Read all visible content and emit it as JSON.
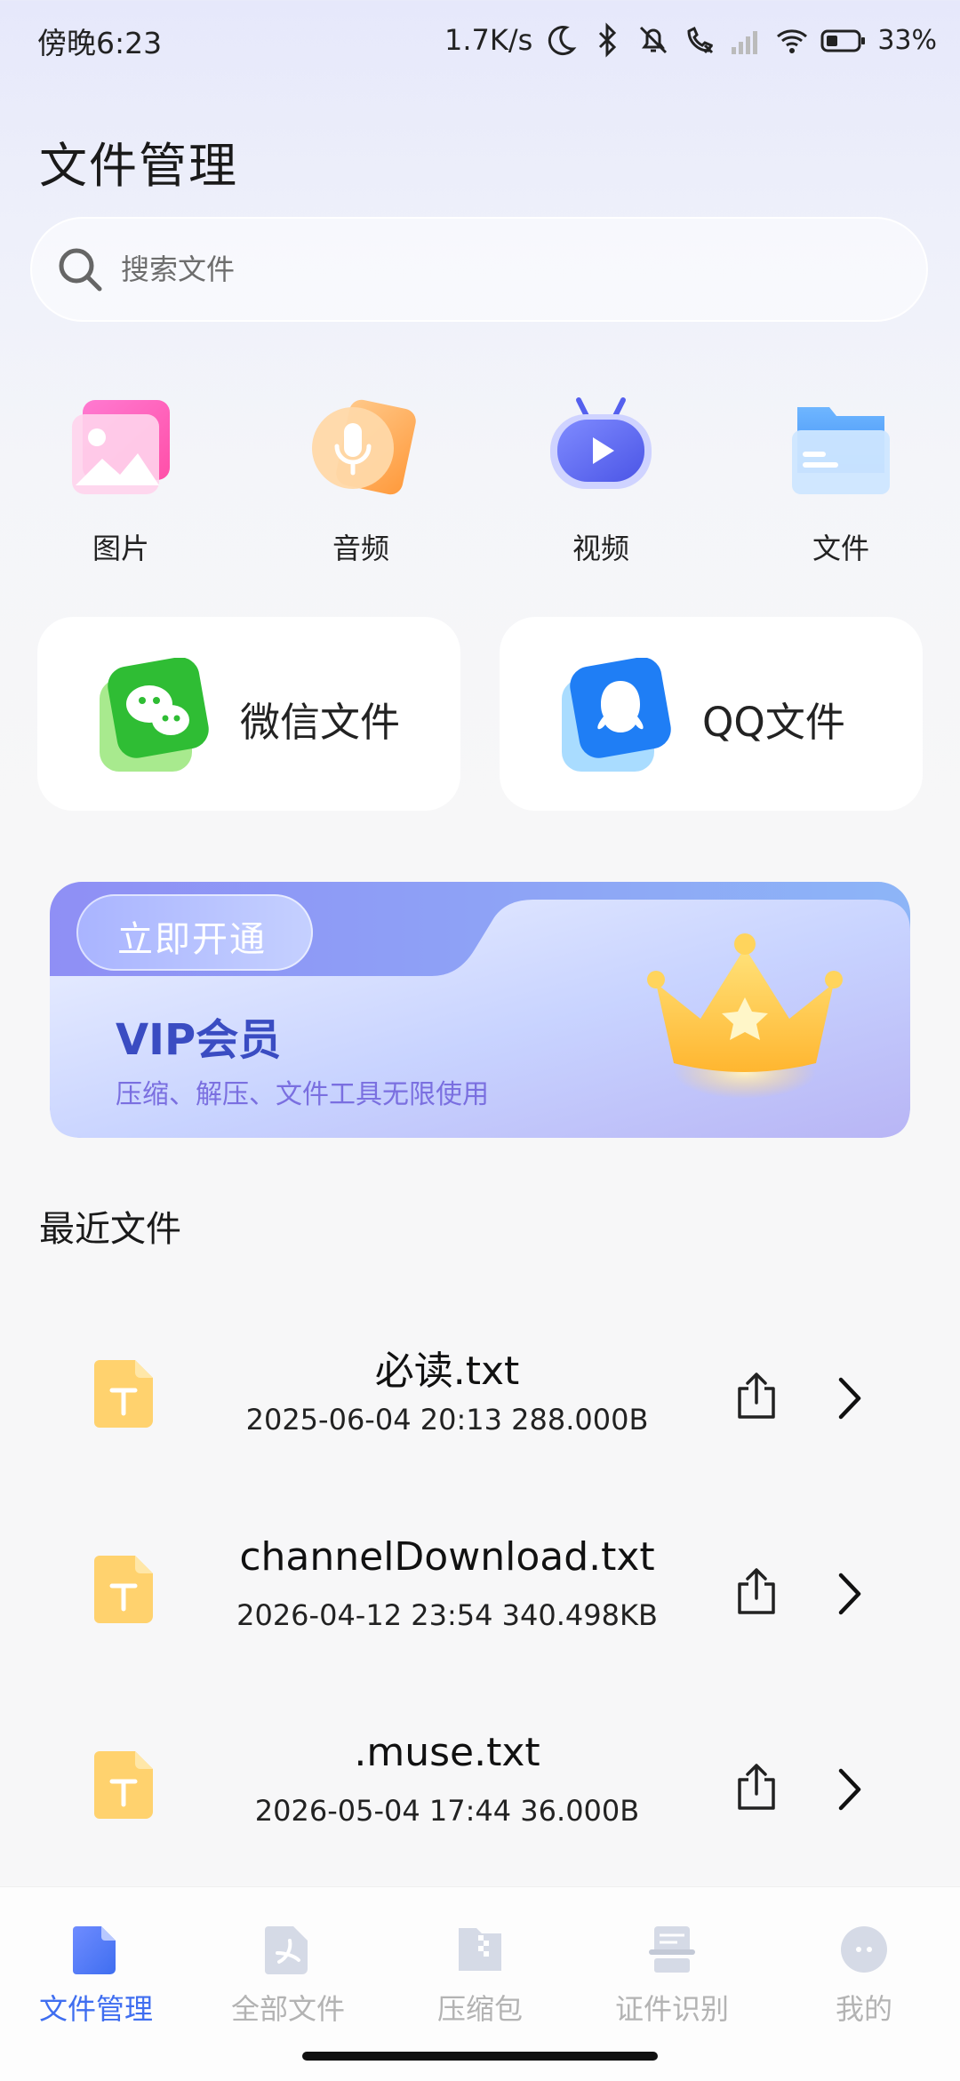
{
  "status_bar": {
    "time": "傍晚6:23",
    "net_speed": "1.7K/s",
    "battery": "33%",
    "icons": [
      "moon-icon",
      "bluetooth-icon",
      "mute-bell-icon",
      "call-icon",
      "signal-icon",
      "wifi-icon",
      "battery-icon"
    ]
  },
  "header": {
    "title": "文件管理"
  },
  "search": {
    "placeholder": "搜索文件"
  },
  "categories": [
    {
      "label": "图片",
      "icon": "image-icon"
    },
    {
      "label": "音频",
      "icon": "audio-icon"
    },
    {
      "label": "视频",
      "icon": "video-icon"
    },
    {
      "label": "文件",
      "icon": "folder-icon"
    }
  ],
  "apps": [
    {
      "label": "微信文件",
      "icon": "wechat-icon"
    },
    {
      "label": "QQ文件",
      "icon": "qq-icon"
    }
  ],
  "vip": {
    "button": "立即开通",
    "title": "VIP会员",
    "subtitle": "压缩、解压、文件工具无限使用"
  },
  "recent": {
    "title": "最近文件",
    "files": [
      {
        "name": "必读.txt",
        "meta": "2025-06-04 20:13 288.000B"
      },
      {
        "name": "channelDownload.txt",
        "meta": "2026-04-12 23:54 340.498KB"
      },
      {
        "name": ".muse.txt",
        "meta": "2026-05-04 17:44 36.000B"
      }
    ]
  },
  "nav": [
    {
      "label": "文件管理",
      "active": true
    },
    {
      "label": "全部文件",
      "active": false
    },
    {
      "label": "压缩包",
      "active": false
    },
    {
      "label": "证件识别",
      "active": false
    },
    {
      "label": "我的",
      "active": false
    }
  ],
  "colors": {
    "accent": "#3f6ef0",
    "vip_title": "#3a4cc2",
    "vip_sub": "#7a6fe0",
    "inactive": "#b3b3b3"
  }
}
